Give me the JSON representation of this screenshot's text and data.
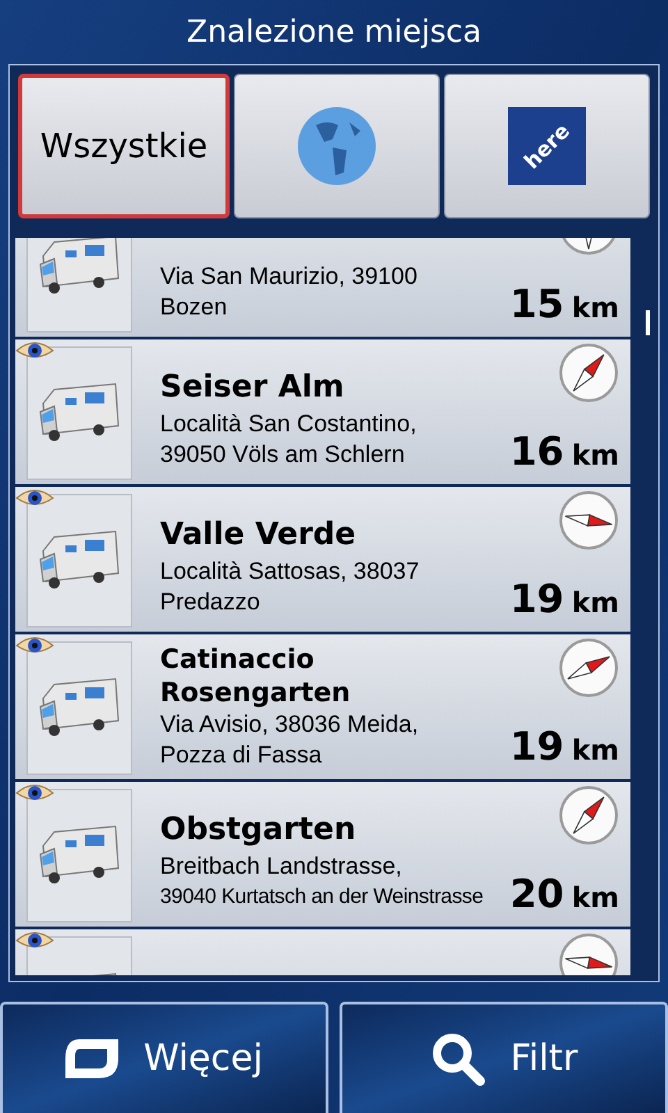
{
  "title": "Znalezione miejsca",
  "tabs": [
    {
      "kind": "text",
      "label": "Wszystkie",
      "selected": true
    },
    {
      "kind": "globe",
      "selected": false
    },
    {
      "kind": "logo",
      "label": "here",
      "selected": false
    }
  ],
  "results": [
    {
      "address": [
        "Via San Maurizio, 39100",
        "Bozen"
      ],
      "distance": "15",
      "unit": "km",
      "eye": false,
      "kind": "north"
    },
    {
      "name": "Seiser Alm",
      "address": [
        "Località San Costantino,",
        "39050 Völs am Schlern"
      ],
      "distance": "16",
      "unit": "km",
      "eye": true,
      "kind": "northeast"
    },
    {
      "name": "Valle Verde",
      "address": [
        "Località Sattosas, 38037",
        "Predazzo"
      ],
      "distance": "19",
      "unit": "km",
      "eye": true,
      "kind": "east"
    },
    {
      "name": "Catinaccio Rosengarten",
      "address": [
        "Via Avisio, 38036 Meida,",
        "Pozza di Fassa"
      ],
      "distance": "19",
      "unit": "km",
      "eye": true,
      "kind": "eastnortheast"
    },
    {
      "name": "Obstgarten",
      "address": [
        "Breitbach Landstrasse,",
        "39040 Kurtatsch an der Weinstrasse"
      ],
      "distance": "20",
      "unit": "km",
      "eye": true,
      "kind": "northeast"
    },
    {
      "eye": true,
      "kind": "east"
    }
  ],
  "buttons": [
    {
      "kind": "more",
      "label": "Więcej"
    },
    {
      "kind": "filter",
      "label": "Filtr"
    }
  ]
}
